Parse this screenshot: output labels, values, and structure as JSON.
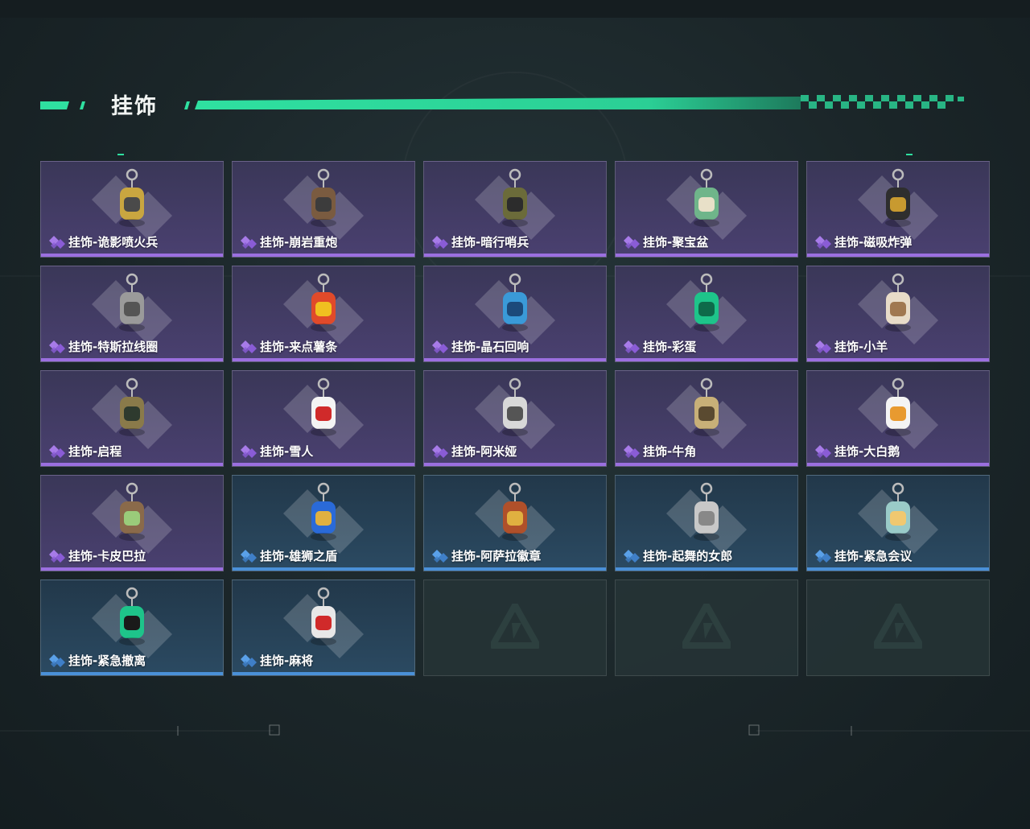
{
  "header": {
    "title": "挂饰"
  },
  "colors": {
    "accent": "#2fe0a0",
    "purple_rarity": "#9b6fe0",
    "blue_rarity": "#4a90d8"
  },
  "items": [
    {
      "label": "挂饰-诡影喷火兵",
      "rarity": "purple",
      "icon": "soldier-charm-icon"
    },
    {
      "label": "挂饰-崩岩重炮",
      "rarity": "purple",
      "icon": "heavy-gunner-charm-icon"
    },
    {
      "label": "挂饰-暗行哨兵",
      "rarity": "purple",
      "icon": "sentinel-charm-icon"
    },
    {
      "label": "挂饰-聚宝盆",
      "rarity": "purple",
      "icon": "treasure-bowl-charm-icon"
    },
    {
      "label": "挂饰-磁吸炸弹",
      "rarity": "purple",
      "icon": "magnetic-bomb-charm-icon"
    },
    {
      "label": "挂饰-特斯拉线圈",
      "rarity": "purple",
      "icon": "tesla-coil-charm-icon"
    },
    {
      "label": "挂饰-来点薯条",
      "rarity": "purple",
      "icon": "fries-charm-icon"
    },
    {
      "label": "挂饰-晶石回响",
      "rarity": "purple",
      "icon": "crystal-charm-icon"
    },
    {
      "label": "挂饰-彩蛋",
      "rarity": "purple",
      "icon": "egg-charm-icon"
    },
    {
      "label": "挂饰-小羊",
      "rarity": "purple",
      "icon": "sheep-charm-icon"
    },
    {
      "label": "挂饰-启程",
      "rarity": "purple",
      "icon": "emblem-charm-icon"
    },
    {
      "label": "挂饰-雪人",
      "rarity": "purple",
      "icon": "snowman-charm-icon"
    },
    {
      "label": "挂饰-阿米娅",
      "rarity": "purple",
      "icon": "amiya-charm-icon"
    },
    {
      "label": "挂饰-牛角",
      "rarity": "purple",
      "icon": "horns-charm-icon"
    },
    {
      "label": "挂饰-大白鹅",
      "rarity": "purple",
      "icon": "goose-charm-icon"
    },
    {
      "label": "挂饰-卡皮巴拉",
      "rarity": "purple",
      "icon": "capybara-charm-icon"
    },
    {
      "label": "挂饰-雄狮之盾",
      "rarity": "blue",
      "icon": "lion-shield-charm-icon"
    },
    {
      "label": "挂饰-阿萨拉徽章",
      "rarity": "blue",
      "icon": "badge-charm-icon"
    },
    {
      "label": "挂饰-起舞的女郎",
      "rarity": "blue",
      "icon": "dancer-charm-icon"
    },
    {
      "label": "挂饰-紧急会议",
      "rarity": "blue",
      "icon": "meeting-charm-icon"
    },
    {
      "label": "挂饰-紧急撤离",
      "rarity": "blue",
      "icon": "evacuation-charm-icon"
    },
    {
      "label": "挂饰-麻将",
      "rarity": "blue",
      "icon": "mahjong-charm-icon"
    },
    {
      "label": "",
      "rarity": "empty",
      "icon": "empty-slot-logo-icon"
    },
    {
      "label": "",
      "rarity": "empty",
      "icon": "empty-slot-logo-icon"
    },
    {
      "label": "",
      "rarity": "empty",
      "icon": "empty-slot-logo-icon"
    }
  ]
}
